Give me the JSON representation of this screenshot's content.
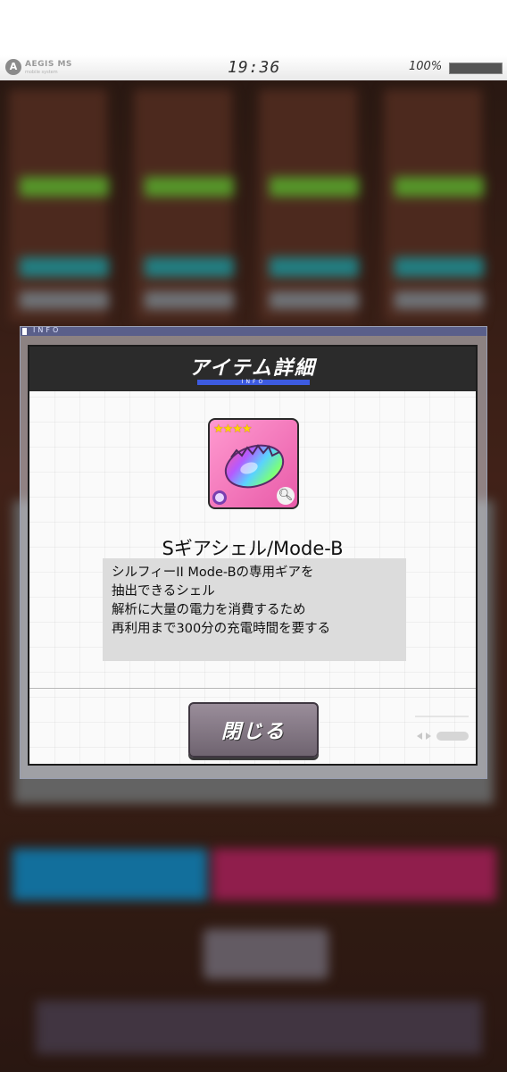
{
  "status_bar": {
    "logo_icon": "aegis-logo-icon",
    "brand": "AEGIS MS",
    "brand_sub": "mobile system",
    "time": "19:36",
    "battery": "100%",
    "battery_level": 1.0
  },
  "frame": {
    "strip_label": "INFO"
  },
  "dialog": {
    "title": "アイテム詳細",
    "title_sub": "INFO",
    "item": {
      "stars": "★★★★",
      "name": "Sギアシェル/Mode-B",
      "description_lines": [
        "シルフィーII Mode-Bの専用ギアを",
        "抽出できるシェル",
        "解析に大量の電力を消費するため",
        "再利用まで300分の充電時間を要する"
      ]
    },
    "close_label": "閉じる"
  },
  "colors": {
    "dialog_header": "#2b2b2b",
    "title_accent": "#3d5be0",
    "icon_bg": "#e85aa8",
    "close_button": "#7f737f",
    "desc_bg": "#dcdcdc"
  }
}
